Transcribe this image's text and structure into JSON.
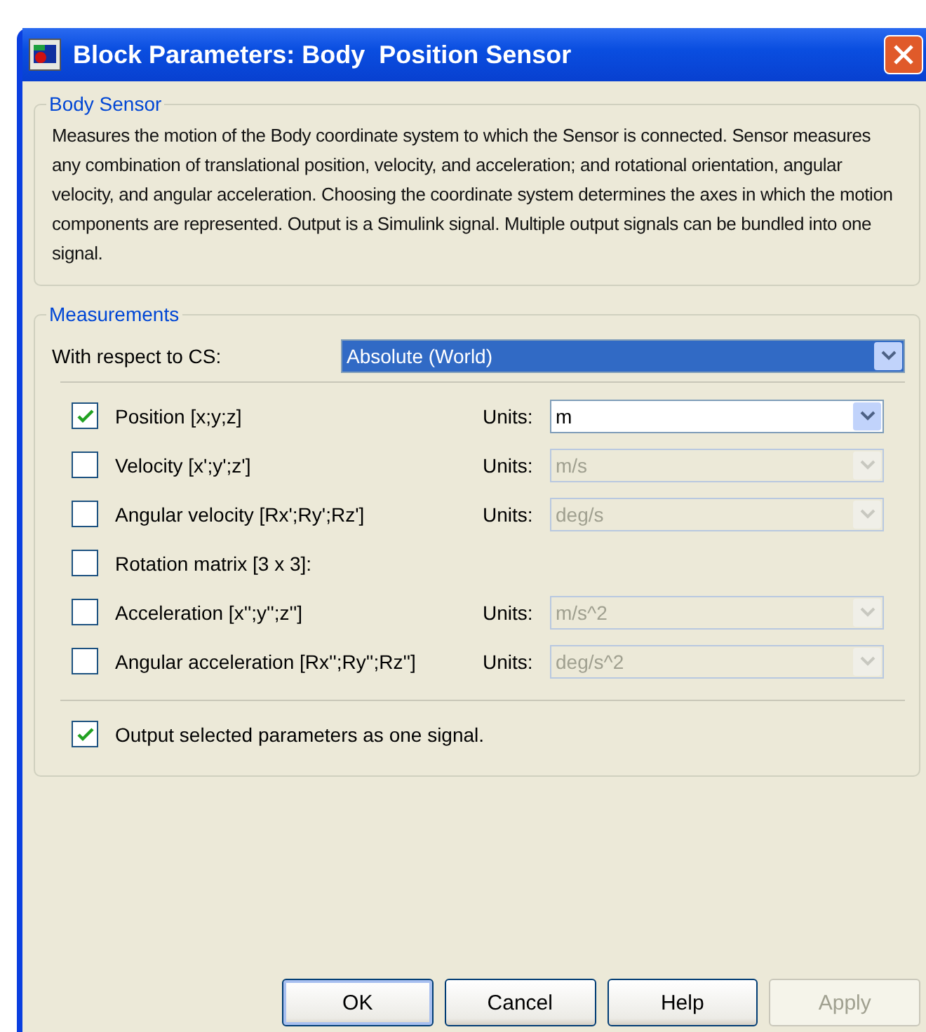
{
  "window": {
    "title": "Block Parameters: Body  Position Sensor"
  },
  "body_sensor": {
    "legend": "Body Sensor",
    "description": "Measures the motion of the Body coordinate system to which the Sensor is connected. Sensor measures any combination of translational position, velocity, and acceleration; and rotational orientation, angular velocity, and angular acceleration. Choosing the coordinate system determines the axes in which the motion components are represented. Output is a Simulink signal. Multiple output signals can be bundled into one signal."
  },
  "measurements": {
    "legend": "Measurements",
    "cs_label": "With respect to CS:",
    "cs_value": "Absolute (World)",
    "items": [
      {
        "label": "Position [x;y;z]",
        "checked": true,
        "units_label": "Units:",
        "units": "m",
        "disabled": false
      },
      {
        "label": "Velocity [x';y';z']",
        "checked": false,
        "units_label": "Units:",
        "units": "m/s",
        "disabled": true
      },
      {
        "label": "Angular velocity [Rx';Ry';Rz']",
        "checked": false,
        "units_label": "Units:",
        "units": "deg/s",
        "disabled": true
      },
      {
        "label": "Rotation matrix [3 x 3]:",
        "checked": false
      },
      {
        "label": "Acceleration [x'';y'';z'']",
        "checked": false,
        "units_label": "Units:",
        "units": "m/s^2",
        "disabled": true
      },
      {
        "label": "Angular acceleration [Rx'';Ry'';Rz'']",
        "checked": false,
        "units_label": "Units:",
        "units": "deg/s^2",
        "disabled": true
      }
    ],
    "output": {
      "label": "Output selected parameters as one signal.",
      "checked": true
    }
  },
  "buttons": [
    {
      "label": "OK",
      "disabled": false,
      "default": true
    },
    {
      "label": "Cancel",
      "disabled": false,
      "default": false
    },
    {
      "label": "Help",
      "disabled": false,
      "default": false
    },
    {
      "label": "Apply",
      "disabled": true,
      "default": false
    }
  ]
}
